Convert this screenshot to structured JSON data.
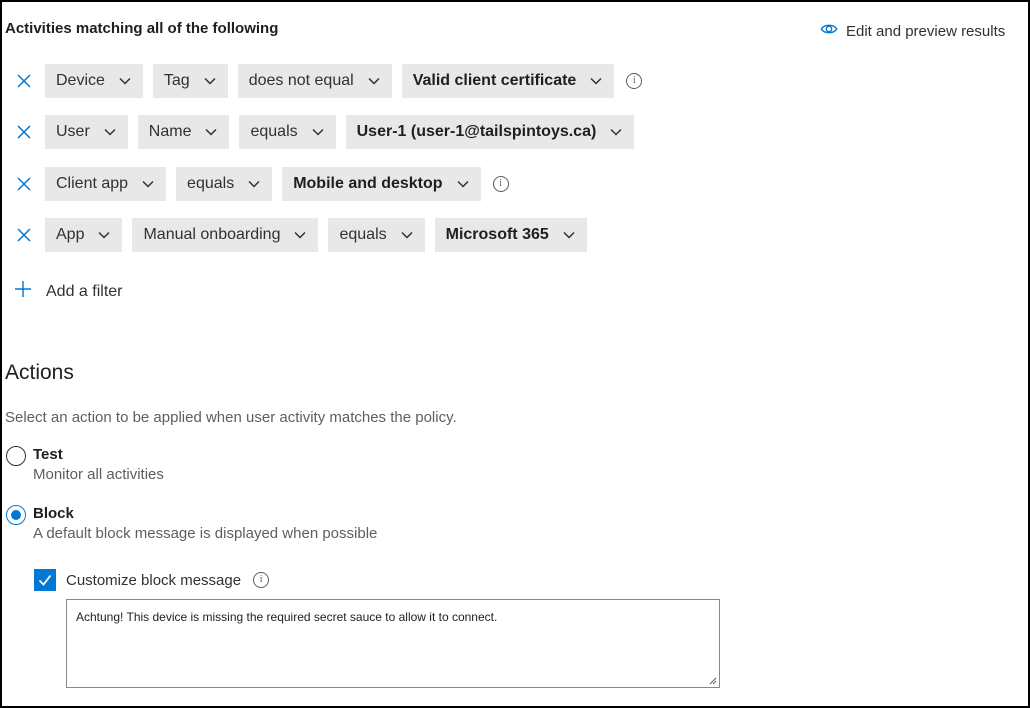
{
  "header": {
    "title": "Activities matching all of the following",
    "preview_label": "Edit and preview results"
  },
  "filters": [
    {
      "field": "Device",
      "sub": "Tag",
      "operator": "does not equal",
      "value": "Valid client certificate",
      "info": true
    },
    {
      "field": "User",
      "sub": "Name",
      "operator": "equals",
      "value": "User-1 (user-1@tailspintoys.ca)",
      "info": false
    },
    {
      "field": "Client app",
      "operator": "equals",
      "value": "Mobile and desktop",
      "info": true
    },
    {
      "field": "App",
      "sub": "Manual onboarding",
      "operator": "equals",
      "value": "Microsoft 365",
      "info": false
    }
  ],
  "add_filter_label": "Add a filter",
  "actions": {
    "title": "Actions",
    "description": "Select an action to be applied when user activity matches the policy.",
    "options": [
      {
        "label": "Test",
        "description": "Monitor all activities",
        "selected": false
      },
      {
        "label": "Block",
        "description": "A default block message is displayed when possible",
        "selected": true
      }
    ],
    "customize_label": "Customize block message",
    "customize_checked": true,
    "message": "Achtung!  This device is missing the required secret sauce to allow it to connect."
  },
  "colors": {
    "accent": "#0078d4",
    "dropdown_bg": "#e8e8e8"
  }
}
